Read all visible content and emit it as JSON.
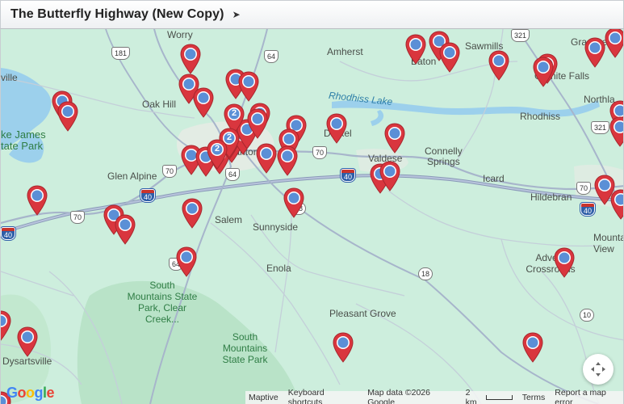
{
  "header": {
    "title": "The Butterfly Highway (New Copy)",
    "arrow": "➤"
  },
  "map": {
    "towns": [
      {
        "name": "Worry"
      },
      {
        "name": "Amherst"
      },
      {
        "name": "Baton"
      },
      {
        "name": "Sawmills"
      },
      {
        "name": "Granite Falls"
      },
      {
        "name": "Gra Che"
      },
      {
        "name": "Oak Hill"
      },
      {
        "name": "Drexel"
      },
      {
        "name": "Rhodhiss"
      },
      {
        "name": "Northla"
      },
      {
        "name": "Morganton"
      },
      {
        "name": "Valdese"
      },
      {
        "name": "Connelly"
      },
      {
        "name": "Springs"
      },
      {
        "name": "Glen Alpine"
      },
      {
        "name": "Icard"
      },
      {
        "name": "Hildebran"
      },
      {
        "name": "Salem"
      },
      {
        "name": "Sunnyside"
      },
      {
        "name": "Enola"
      },
      {
        "name": "Advent Crossroads"
      },
      {
        "name": "Mounta View"
      },
      {
        "name": "Pleasant Grove"
      },
      {
        "name": "Dysartsville"
      },
      {
        "name": "ville"
      }
    ],
    "lakes": [
      {
        "name": "Rhodhiss Lake"
      },
      {
        "name": "ke James"
      }
    ],
    "parks": [
      {
        "name": "South Mountains State Park, Clear Creek..."
      },
      {
        "name": "South Mountains State Park"
      },
      {
        "name": "tate Park"
      }
    ],
    "shields": [
      "181",
      "64",
      "321",
      "70",
      "40",
      "64",
      "18",
      "70",
      "40",
      "18",
      "64",
      "40",
      "321",
      "70",
      "10",
      "40"
    ],
    "cluster_counts": [
      "2",
      "2",
      "2"
    ],
    "marker_color": "#d9363e",
    "marker_dot_color": "#5b8fd6",
    "controls": {
      "locate_icon": "crosshair-icon"
    }
  },
  "footer": {
    "logo": "Google",
    "maptive": "Maptive",
    "shortcuts": "Keyboard shortcuts",
    "map_data": "Map data ©2026 Google",
    "scale": "2 km",
    "terms": "Terms",
    "report": "Report a map error"
  }
}
